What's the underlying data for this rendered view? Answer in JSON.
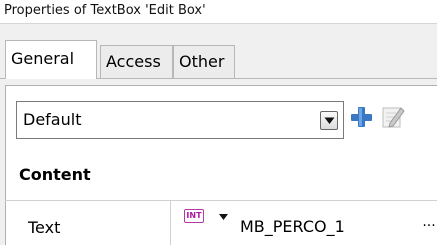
{
  "window": {
    "title": "Properties of TextBox 'Edit Box'"
  },
  "tabs": [
    {
      "label": "General",
      "active": true
    },
    {
      "label": "Access",
      "active": false
    },
    {
      "label": "Other",
      "active": false
    }
  ],
  "style_selector": {
    "value": "Default"
  },
  "icons": {
    "add": "plus-icon",
    "edit": "edit-pencil-icon",
    "dropdown": "chevron-down-icon",
    "type": "int-type-icon"
  },
  "colors": {
    "plus": "#3a78c4",
    "type_badge": "#b0189e"
  },
  "properties": {
    "section": "Content",
    "rows": [
      {
        "label": "Text",
        "type_badge": "INT",
        "value": "MB_PERCO_1",
        "more": "..."
      }
    ]
  }
}
